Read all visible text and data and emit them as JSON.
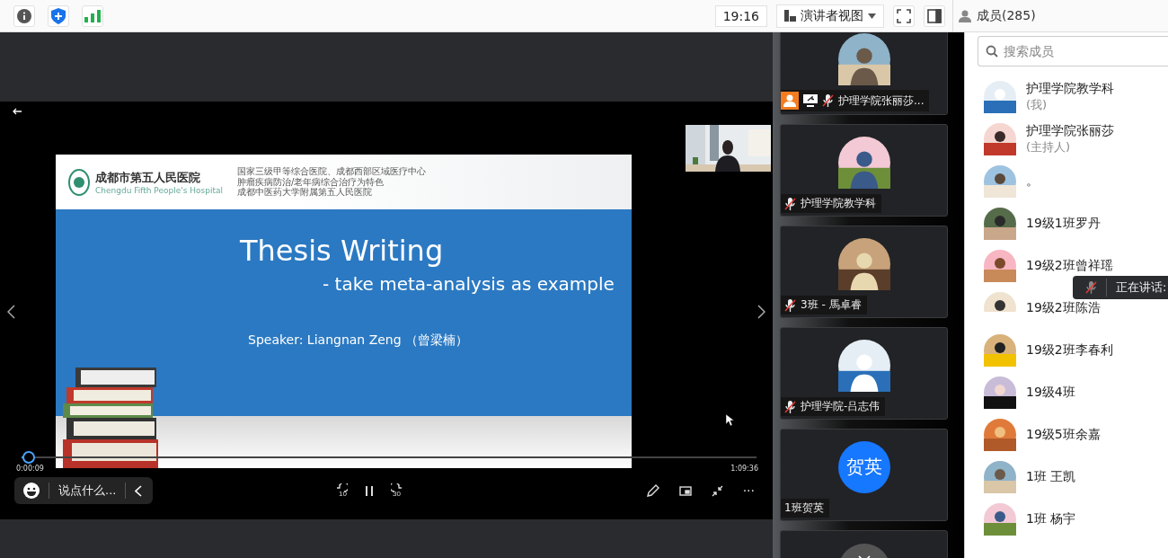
{
  "toolbar": {
    "time": "19:16",
    "view_menu": "演讲者视图",
    "members_label": "成员(285)"
  },
  "slide": {
    "hospital_name": "成都市第五人民医院",
    "hospital_name_en": "Chengdu Fifth People's Hospital",
    "hospital_lines": [
      "国家三级甲等综合医院、成都西部区域医疗中心",
      "肿瘤疾病防治/老年病综合治疗为特色",
      "成都中医药大学附属第五人民医院"
    ],
    "title": "Thesis Writing",
    "subtitle": "- take meta-analysis as example",
    "speaker": "Speaker: Liangnan Zeng （曾梁楠）"
  },
  "player": {
    "elapsed": "0:00:09",
    "duration": "1:09:36",
    "level": 0.01,
    "chat_placeholder": "说点什么...",
    "rewind": "10",
    "forward": "30",
    "more": "···"
  },
  "video_tiles": [
    {
      "name": "护理学院张丽莎...",
      "kind": "picture",
      "host": true,
      "sharing": true,
      "muted": true
    },
    {
      "name": "护理学院教学科",
      "kind": "picture",
      "host": false,
      "sharing": false,
      "muted": true
    },
    {
      "name": "3班 - 馬卓睿",
      "kind": "picture",
      "host": false,
      "sharing": false,
      "muted": true
    },
    {
      "name": "护理学院-吕志伟",
      "kind": "picture",
      "host": false,
      "sharing": false,
      "muted": true
    },
    {
      "name": "1班贺英",
      "kind": "initials",
      "initials": "贺英",
      "host": false,
      "sharing": false,
      "muted": false
    }
  ],
  "members": {
    "search_placeholder": "搜索成员",
    "items": [
      {
        "name": "护理学院教学科",
        "role": "(我)"
      },
      {
        "name": "护理学院张丽莎",
        "role": "(主持人)"
      },
      {
        "name": "。"
      },
      {
        "name": "19级1班罗丹"
      },
      {
        "name": "19级2班曾祥瑶"
      },
      {
        "name": "19级2班陈浩"
      },
      {
        "name": "19级2班李春利"
      },
      {
        "name": "19级4班"
      },
      {
        "name": "19级5班余嘉"
      },
      {
        "name": "1班 王凯"
      },
      {
        "name": "1班 杨宇"
      }
    ]
  },
  "speaking_toast": {
    "label": "正在讲话:"
  }
}
